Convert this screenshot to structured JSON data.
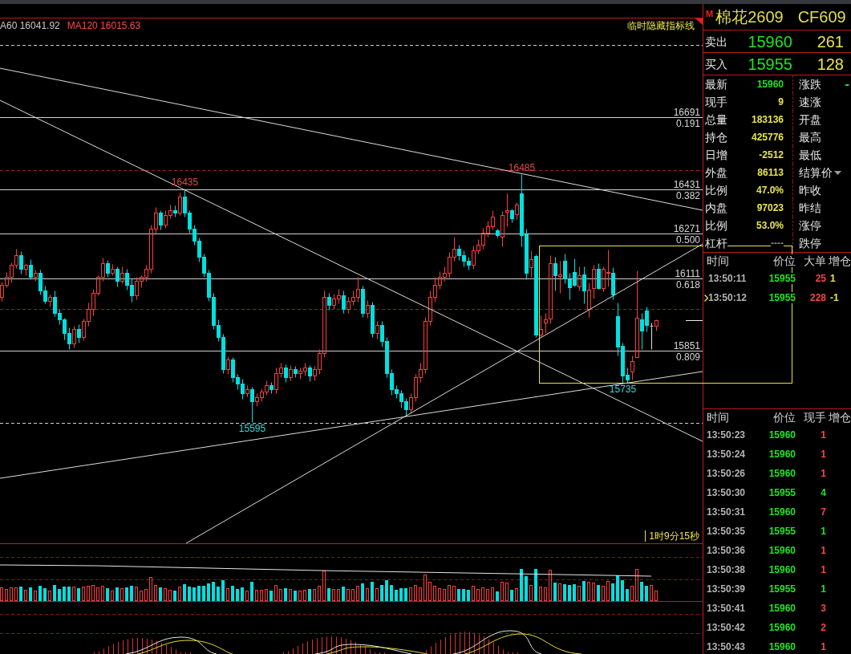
{
  "main_chart": {
    "legend": [
      {
        "text": "A60 16041.92",
        "color": "#c8c8c8"
      },
      {
        "text": "MA120 16015.63",
        "color": "#ff4848"
      }
    ],
    "toggle_label": "临时隐藏指标线",
    "countdown": "1时9分15秒",
    "fibonacci_ratios": [
      "0.191",
      "0.382",
      "0.500",
      "0.618",
      "0.809"
    ],
    "drawing_tools": [
      {
        "kind": "trend_line"
      },
      {
        "kind": "trend_line"
      },
      {
        "kind": "trend_line"
      },
      {
        "kind": "trend_line"
      },
      {
        "kind": "rectangle"
      }
    ],
    "chart_data": {
      "type": "candlestick",
      "categories": [
        null,
        null,
        null,
        null,
        null,
        null,
        null,
        null,
        null,
        null,
        null,
        null,
        null,
        null,
        null,
        null,
        null,
        null,
        null,
        null,
        null,
        null,
        null,
        null,
        null,
        null,
        null,
        null,
        null,
        null,
        null,
        null,
        null,
        null,
        null,
        null,
        null,
        null,
        null,
        null,
        null,
        null,
        null,
        null,
        null,
        null,
        null,
        null,
        null,
        null,
        null,
        null,
        null,
        null,
        null,
        null,
        null,
        null,
        null,
        null,
        null,
        null,
        null,
        null,
        null,
        null,
        null,
        null,
        null,
        null,
        null,
        null,
        null,
        null,
        null,
        null,
        null,
        null,
        null,
        null,
        null,
        null,
        null,
        null,
        null,
        null,
        null,
        null,
        null,
        null,
        null,
        null,
        null,
        null,
        null,
        null,
        null,
        null,
        null,
        null,
        null,
        null,
        null,
        null,
        null,
        null,
        null,
        null,
        null,
        null,
        null,
        null,
        null,
        null,
        null,
        null,
        null,
        null,
        null,
        null,
        null,
        null,
        null,
        null,
        null,
        null,
        null,
        null,
        null,
        null,
        null,
        null,
        null,
        null,
        null,
        null,
        null
      ],
      "ylim": [
        15158,
        17049
      ],
      "yticks": [
        15851,
        16111,
        16271,
        16431,
        16691
      ],
      "grid": true,
      "ohlc": [
        [
          16044,
          16099,
          16030,
          16088
        ],
        [
          16088,
          16134,
          16079,
          16116
        ],
        [
          16116,
          16168,
          16096,
          16160
        ],
        [
          16160,
          16218,
          16148,
          16194
        ],
        [
          16194,
          16209,
          16128,
          16145
        ],
        [
          16145,
          16166,
          16122,
          16160
        ],
        [
          16160,
          16180,
          16108,
          16116
        ],
        [
          16116,
          16143,
          16102,
          16131
        ],
        [
          16131,
          16142,
          16053,
          16067
        ],
        [
          16067,
          16085,
          16021,
          16030
        ],
        [
          16030,
          16053,
          16010,
          16044
        ],
        [
          16044,
          16067,
          15975,
          15987
        ],
        [
          15987,
          16001,
          15946,
          15963
        ],
        [
          15963,
          15969,
          15891,
          15914
        ],
        [
          15914,
          15935,
          15857,
          15877
        ],
        [
          15877,
          15940,
          15862,
          15929
        ],
        [
          15929,
          15946,
          15880,
          15900
        ],
        [
          15900,
          15966,
          15888,
          15958
        ],
        [
          15958,
          16024,
          15940,
          16001
        ],
        [
          16001,
          16073,
          15978,
          16059
        ],
        [
          16059,
          16122,
          16050,
          16116
        ],
        [
          16116,
          16186,
          16102,
          16166
        ],
        [
          16166,
          16177,
          16116,
          16131
        ],
        [
          16131,
          16163,
          16122,
          16145
        ],
        [
          16145,
          16154,
          16082,
          16102
        ],
        [
          16102,
          16154,
          16093,
          16131
        ],
        [
          16131,
          16145,
          16070,
          16088
        ],
        [
          16088,
          16111,
          16027,
          16050
        ],
        [
          16050,
          16116,
          16036,
          16102
        ],
        [
          16102,
          16122,
          16079,
          16116
        ],
        [
          16116,
          16160,
          16102,
          16145
        ],
        [
          16145,
          16304,
          16131,
          16290
        ],
        [
          16290,
          16368,
          16275,
          16347
        ],
        [
          16347,
          16356,
          16287,
          16304
        ],
        [
          16304,
          16356,
          16293,
          16339
        ],
        [
          16339,
          16376,
          16327,
          16356
        ],
        [
          16356,
          16373,
          16333,
          16347
        ],
        [
          16347,
          16420,
          16339,
          16405
        ],
        [
          16405,
          16435,
          16333,
          16347
        ],
        [
          16347,
          16356,
          16275,
          16290
        ],
        [
          16290,
          16304,
          16232,
          16246
        ],
        [
          16246,
          16258,
          16171,
          16189
        ],
        [
          16189,
          16200,
          16116,
          16131
        ],
        [
          16131,
          16142,
          16030,
          16044
        ],
        [
          16044,
          16059,
          15929,
          15943
        ],
        [
          15943,
          15963,
          15886,
          15900
        ],
        [
          15900,
          15912,
          15770,
          15784
        ],
        [
          15784,
          15831,
          15767,
          15819
        ],
        [
          15819,
          15828,
          15738,
          15756
        ],
        [
          15756,
          15767,
          15712,
          15732
        ],
        [
          15732,
          15750,
          15678,
          15698
        ],
        [
          15698,
          15727,
          15686,
          15712
        ],
        [
          15712,
          15721,
          15595,
          15669
        ],
        [
          15669,
          15698,
          15652,
          15683
        ],
        [
          15683,
          15715,
          15669,
          15704
        ],
        [
          15704,
          15744,
          15692,
          15727
        ],
        [
          15727,
          15738,
          15698,
          15712
        ],
        [
          15712,
          15790,
          15698,
          15770
        ],
        [
          15770,
          15808,
          15756,
          15790
        ],
        [
          15790,
          15802,
          15738,
          15756
        ],
        [
          15756,
          15799,
          15744,
          15784
        ],
        [
          15784,
          15796,
          15756,
          15770
        ],
        [
          15770,
          15790,
          15750,
          15779
        ],
        [
          15779,
          15808,
          15761,
          15790
        ],
        [
          15790,
          15799,
          15741,
          15761
        ],
        [
          15761,
          15796,
          15744,
          15784
        ],
        [
          15784,
          15857,
          15767,
          15842
        ],
        [
          15842,
          16067,
          15828,
          16044
        ],
        [
          16044,
          16059,
          15998,
          16015
        ],
        [
          16015,
          16056,
          16001,
          16039
        ],
        [
          16039,
          16073,
          16021,
          16050
        ],
        [
          16050,
          16067,
          15987,
          16001
        ],
        [
          16001,
          16044,
          15987,
          16030
        ],
        [
          16030,
          16067,
          16015,
          16044
        ],
        [
          16044,
          16116,
          16027,
          16073
        ],
        [
          16073,
          16085,
          15972,
          15987
        ],
        [
          15987,
          16033,
          15969,
          16015
        ],
        [
          16015,
          16027,
          15900,
          15914
        ],
        [
          15914,
          15958,
          15894,
          15943
        ],
        [
          15943,
          15958,
          15865,
          15886
        ],
        [
          15886,
          15900,
          15756,
          15770
        ],
        [
          15770,
          15784,
          15692,
          15712
        ],
        [
          15712,
          15727,
          15681,
          15698
        ],
        [
          15698,
          15709,
          15646,
          15669
        ],
        [
          15669,
          15681,
          15617,
          15640
        ],
        [
          15640,
          15698,
          15626,
          15683
        ],
        [
          15683,
          15767,
          15669,
          15756
        ],
        [
          15756,
          15808,
          15738,
          15784
        ],
        [
          15784,
          15972,
          15770,
          15958
        ],
        [
          15958,
          16067,
          15943,
          16044
        ],
        [
          16044,
          16116,
          16027,
          16088
        ],
        [
          16088,
          16137,
          16073,
          16116
        ],
        [
          16116,
          16154,
          16102,
          16131
        ],
        [
          16131,
          16206,
          16113,
          16189
        ],
        [
          16189,
          16261,
          16174,
          16218
        ],
        [
          16218,
          16232,
          16177,
          16194
        ],
        [
          16194,
          16212,
          16154,
          16174
        ],
        [
          16174,
          16189,
          16143,
          16160
        ],
        [
          16160,
          16229,
          16145,
          16212
        ],
        [
          16212,
          16252,
          16200,
          16232
        ],
        [
          16232,
          16293,
          16218,
          16275
        ],
        [
          16275,
          16319,
          16261,
          16298
        ],
        [
          16298,
          16356,
          16287,
          16333
        ],
        [
          16284,
          16290,
          16258,
          16267
        ],
        [
          16261,
          16353,
          16226,
          16339
        ],
        [
          16350,
          16417,
          16298,
          16356
        ],
        [
          16356,
          16362,
          16313,
          16327
        ],
        [
          16342,
          16385,
          16324,
          16376
        ],
        [
          16417,
          16485,
          16226,
          16267
        ],
        [
          16270,
          16290,
          16108,
          16131
        ],
        [
          16151,
          16212,
          16116,
          16180
        ],
        [
          16192,
          16197,
          15900,
          15909
        ],
        [
          15909,
          15978,
          15900,
          15929
        ],
        [
          15952,
          15987,
          15914,
          15964
        ],
        [
          15966,
          16195,
          15949,
          16166
        ],
        [
          16166,
          16189,
          16067,
          16122
        ],
        [
          16119,
          16174,
          16059,
          16125
        ],
        [
          16174,
          16200,
          16093,
          16111
        ],
        [
          16108,
          16131,
          16036,
          16079
        ],
        [
          16134,
          16183,
          16082,
          16088
        ],
        [
          16082,
          16154,
          16067,
          16122
        ],
        [
          16125,
          16154,
          16021,
          16067
        ],
        [
          16001,
          16096,
          15972,
          16070
        ],
        [
          16076,
          16160,
          16039,
          16145
        ],
        [
          16145,
          16166,
          16073,
          16076
        ],
        [
          16076,
          16154,
          16064,
          16145
        ],
        [
          16131,
          16215,
          16082,
          16134
        ],
        [
          16131,
          16151,
          16036,
          16053
        ],
        [
          15975,
          16024,
          15834,
          15865
        ],
        [
          15868,
          15880,
          15735,
          15761
        ],
        [
          15764,
          15790,
          15735,
          15747
        ],
        [
          15776,
          15834,
          15747,
          15813
        ],
        [
          15828,
          16140,
          15828,
          15969
        ],
        [
          15964,
          15987,
          15857,
          15923
        ],
        [
          15995,
          16010,
          15920,
          15943
        ],
        [
          15940,
          15952,
          15857,
          15940
        ],
        [
          15940,
          15964,
          15923,
          15961
        ]
      ],
      "ref_lines": [
        {
          "axis": "y",
          "value": 16950,
          "color": "#d0d0d0",
          "line_style": "dashed"
        },
        {
          "axis": "y",
          "value": 16500,
          "color": "#a02020",
          "line_style": "dashed"
        },
        {
          "axis": "y",
          "value": 16000,
          "color": "#a02020",
          "line_style": "dashed"
        },
        {
          "axis": "y",
          "value": 15590,
          "color": "#d0d0d0",
          "line_style": "dashed"
        }
      ],
      "annotations": [
        "16435",
        "15595",
        "16485",
        "15735"
      ]
    }
  },
  "quote_panel": {
    "flag": "M",
    "name": "棉花2609",
    "code": "CF609",
    "order_book": [
      {
        "label": "卖出",
        "price": "15960",
        "volume": "261"
      },
      {
        "label": "买入",
        "price": "15955",
        "volume": "128"
      }
    ],
    "stats": [
      {
        "left": {
          "label": "最新",
          "value": "15960",
          "color": "#22e022"
        },
        "right": {
          "label": "涨跌",
          "value": "-",
          "color": "#22e022",
          "has_menu": false
        }
      },
      {
        "left": {
          "label": "现手",
          "value": "9",
          "color": "#e8e44c"
        },
        "right": {
          "label": "速涨",
          "has_menu": false
        }
      },
      {
        "left": {
          "label": "总量",
          "value": "183136",
          "color": "#e8e44c"
        },
        "right": {
          "label": "开盘",
          "has_menu": false
        }
      },
      {
        "left": {
          "label": "持仓",
          "value": "425776",
          "color": "#e8e44c"
        },
        "right": {
          "label": "最高",
          "has_menu": false
        }
      },
      {
        "left": {
          "label": "日增",
          "value": "-2512",
          "color": "#e8e44c"
        },
        "right": {
          "label": "最低",
          "has_menu": false
        }
      },
      {
        "left": {
          "label": "外盘",
          "value": "86113",
          "color": "#e8e44c"
        },
        "right": {
          "label": "结算价",
          "has_menu": true
        }
      },
      {
        "left": {
          "label": "比例",
          "value": "47.0%",
          "color": "#e8e44c"
        },
        "right": {
          "label": "昨收",
          "has_menu": false
        }
      },
      {
        "left": {
          "label": "内盘",
          "value": "97023",
          "color": "#e8e44c"
        },
        "right": {
          "label": "昨结",
          "has_menu": false
        }
      },
      {
        "left": {
          "label": "比例",
          "value": "53.0%",
          "color": "#e8e44c"
        },
        "right": {
          "label": "涨停",
          "has_menu": false
        }
      },
      {
        "left": {
          "label": "杠杆",
          "value": "----",
          "color": "#8a8a8a"
        },
        "right": {
          "label": "跌停",
          "has_menu": false
        }
      }
    ],
    "big_orders": {
      "columns": [
        "时间",
        "价位",
        "大单",
        "增仓"
      ],
      "rows": [
        {
          "time": "13:50:11",
          "price": "15955",
          "volume": "25",
          "color": "#f04848",
          "change": "1",
          "selected": false
        },
        {
          "time": "13:50:12",
          "price": "15955",
          "volume": "228",
          "color": "#f04848",
          "change": "-1",
          "selected": true
        }
      ]
    },
    "trades": {
      "columns": [
        "时间",
        "价位",
        "现手",
        "增仓"
      ],
      "rows": [
        {
          "time": "13:50:23",
          "price": "15960",
          "volume": "1",
          "color": "#f04848"
        },
        {
          "time": "13:50:24",
          "price": "15960",
          "volume": "1",
          "color": "#f04848"
        },
        {
          "time": "13:50:26",
          "price": "15960",
          "volume": "1",
          "color": "#f04848"
        },
        {
          "time": "13:50:30",
          "price": "15955",
          "volume": "4",
          "color": "#22e022"
        },
        {
          "time": "13:50:31",
          "price": "15960",
          "volume": "7",
          "color": "#f04848"
        },
        {
          "time": "13:50:35",
          "price": "15955",
          "volume": "1",
          "color": "#22e022"
        },
        {
          "time": "13:50:36",
          "price": "15960",
          "volume": "1",
          "color": "#f04848"
        },
        {
          "time": "13:50:38",
          "price": "15960",
          "volume": "1",
          "color": "#f04848"
        },
        {
          "time": "13:50:39",
          "price": "15955",
          "volume": "1",
          "color": "#22e022"
        },
        {
          "time": "13:50:41",
          "price": "15960",
          "volume": "3",
          "color": "#f04848"
        },
        {
          "time": "13:50:42",
          "price": "15960",
          "volume": "2",
          "color": "#f04848"
        },
        {
          "time": "13:50:43",
          "price": "15960",
          "volume": "1",
          "color": "#f04848"
        }
      ]
    }
  }
}
